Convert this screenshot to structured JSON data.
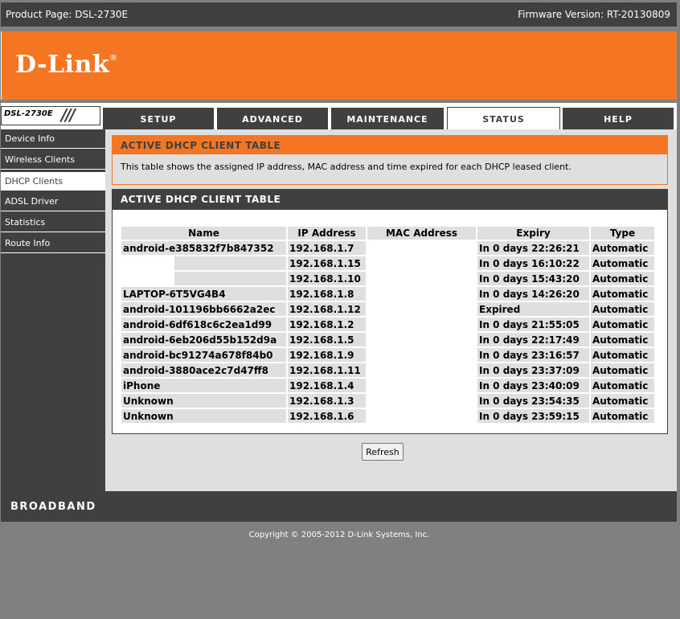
{
  "header": {
    "product_page": "Product Page: DSL-2730E",
    "firmware_version": "Firmware Version: RT-20130809"
  },
  "brand": {
    "logo": "D-Link",
    "registered": "®"
  },
  "model_badge": "DSL-2730E",
  "tabs": [
    {
      "label": "SETUP",
      "active": false
    },
    {
      "label": "ADVANCED",
      "active": false
    },
    {
      "label": "MAINTENANCE",
      "active": false
    },
    {
      "label": "STATUS",
      "active": true
    },
    {
      "label": "HELP",
      "active": false
    }
  ],
  "sidebar": {
    "items": [
      {
        "label": "Device Info",
        "active": false
      },
      {
        "label": "Wireless Clients",
        "active": false
      },
      {
        "label": "DHCP Clients",
        "active": true
      },
      {
        "label": "ADSL Driver",
        "active": false
      },
      {
        "label": "Statistics",
        "active": false
      },
      {
        "label": "Route Info",
        "active": false
      }
    ]
  },
  "intro": {
    "title": "ACTIVE DHCP CLIENT TABLE",
    "description": "This table shows the assigned IP address, MAC address and time expired for each DHCP leased client."
  },
  "client_table": {
    "title": "ACTIVE DHCP CLIENT TABLE",
    "columns": [
      "Name",
      "IP Address",
      "MAC Address",
      "Expiry",
      "Type"
    ],
    "rows": [
      {
        "name": "android-e385832f7b847352",
        "ip": "192.168.1.7",
        "mac": "",
        "expiry": "In 0 days 22:26:21",
        "type": "Automatic"
      },
      {
        "name": "",
        "ip": "192.168.1.15",
        "mac": "",
        "expiry": "In 0 days 16:10:22",
        "type": "Automatic"
      },
      {
        "name": "",
        "ip": "192.168.1.10",
        "mac": "",
        "expiry": "In 0 days 15:43:20",
        "type": "Automatic"
      },
      {
        "name": "LAPTOP-6T5VG4B4",
        "ip": "192.168.1.8",
        "mac": "",
        "expiry": "In 0 days 14:26:20",
        "type": "Automatic"
      },
      {
        "name": "android-101196bb6662a2ec",
        "ip": "192.168.1.12",
        "mac": "",
        "expiry": "Expired",
        "type": "Automatic"
      },
      {
        "name": "android-6df618c6c2ea1d99",
        "ip": "192.168.1.2",
        "mac": "",
        "expiry": "In 0 days 21:55:05",
        "type": "Automatic"
      },
      {
        "name": "android-6eb206d55b152d9a",
        "ip": "192.168.1.5",
        "mac": "",
        "expiry": "In 0 days 22:17:49",
        "type": "Automatic"
      },
      {
        "name": "android-bc91274a678f84b0",
        "ip": "192.168.1.9",
        "mac": "",
        "expiry": "In 0 days 23:16:57",
        "type": "Automatic"
      },
      {
        "name": "android-3880ace2c7d47ff8",
        "ip": "192.168.1.11",
        "mac": "",
        "expiry": "In 0 days 23:37:09",
        "type": "Automatic"
      },
      {
        "name": "iPhone",
        "ip": "192.168.1.4",
        "mac": "",
        "expiry": "In 0 days 23:40:09",
        "type": "Automatic"
      },
      {
        "name": "Unknown",
        "ip": "192.168.1.3",
        "mac": "",
        "expiry": "In 0 days 23:54:35",
        "type": "Automatic"
      },
      {
        "name": "Unknown",
        "ip": "192.168.1.6",
        "mac": "",
        "expiry": "In 0 days 23:59:15",
        "type": "Automatic"
      }
    ]
  },
  "refresh_label": "Refresh",
  "footer": {
    "broadband": "BROADBAND",
    "copyright": "Copyright © 2005-2012 D-Link Systems, Inc."
  },
  "colors": {
    "accent": "#f47623",
    "dark": "#404040",
    "panel": "#dfdfdf",
    "page_bg": "#808080"
  }
}
